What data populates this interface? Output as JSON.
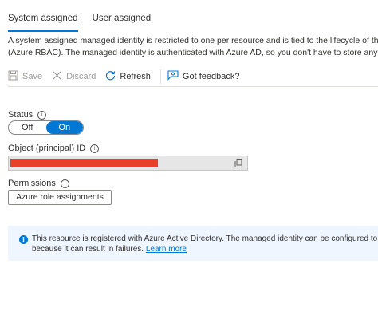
{
  "tabs": [
    {
      "label": "System assigned",
      "active": true
    },
    {
      "label": "User assigned",
      "active": false
    }
  ],
  "description": {
    "line1": "A system assigned managed identity is restricted to one per resource and is tied to the lifecycle of this resource.",
    "line2": "(Azure RBAC). The managed identity is authenticated with Azure AD, so you don't have to store any credentials"
  },
  "toolbar": {
    "save": "Save",
    "discard": "Discard",
    "refresh": "Refresh",
    "feedback": "Got feedback?"
  },
  "status": {
    "label": "Status",
    "off": "Off",
    "on": "On",
    "selected": "On"
  },
  "object_id": {
    "label": "Object (principal) ID",
    "value_redacted": true
  },
  "permissions": {
    "label": "Permissions",
    "button": "Azure role assignments"
  },
  "banner": {
    "line1": "This resource is registered with Azure Active Directory. The managed identity can be configured to allow access to",
    "line2": "because it can result in failures.",
    "link": "Learn more"
  },
  "colors": {
    "accent": "#0078d4",
    "redaction": "#e8412b",
    "banner_bg": "#f0f6ff"
  }
}
